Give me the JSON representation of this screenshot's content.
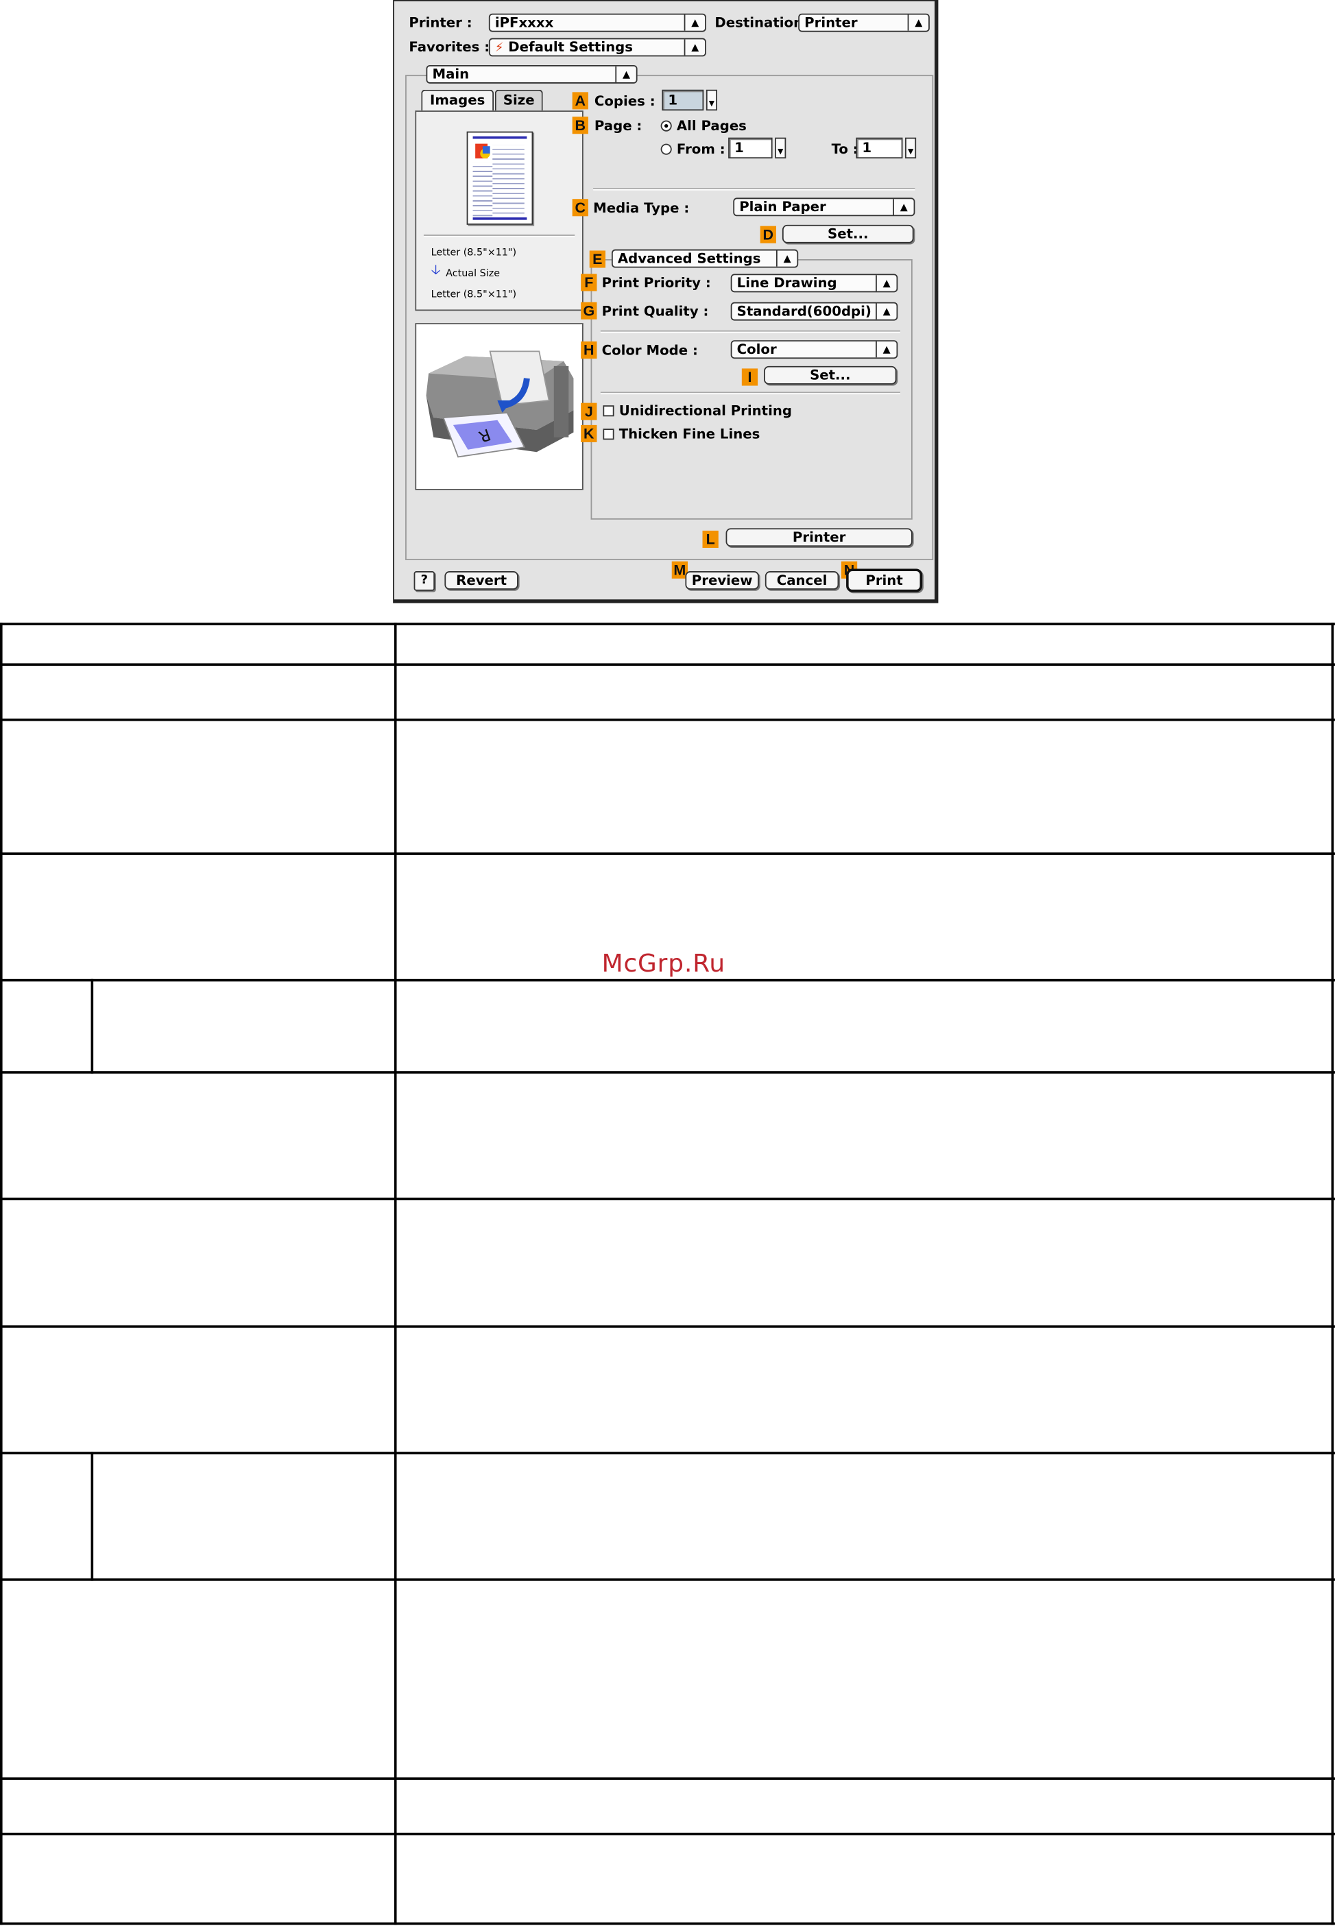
{
  "dialog": {
    "printer_label": "Printer :",
    "printer_value": "iPFxxxx",
    "destination_label": "Destination :",
    "destination_value": "Printer",
    "favorites_label": "Favorites :",
    "favorites_value": "Default Settings",
    "panel_value": "Main",
    "tabs": [
      "Images",
      "Size"
    ],
    "preview": {
      "paper_size_top": "Letter (8.5\"×11\")",
      "scale_label": "Actual Size",
      "paper_size_bottom": "Letter (8.5\"×11\")"
    },
    "copies_label": "Copies :",
    "copies_value": "1",
    "page_label": "Page :",
    "all_pages_label": "All Pages",
    "from_label": "From :",
    "from_value": "1",
    "to_label": "To :",
    "to_value": "1",
    "media_type_label": "Media Type :",
    "media_type_value": "Plain Paper",
    "media_set_button": "Set...",
    "advanced_settings_value": "Advanced Settings",
    "print_priority_label": "Print Priority :",
    "print_priority_value": "Line Drawing",
    "print_quality_label": "Print Quality :",
    "print_quality_value": "Standard(600dpi)",
    "color_mode_label": "Color Mode :",
    "color_mode_value": "Color",
    "color_set_button": "Set...",
    "unidirectional_label": "Unidirectional Printing",
    "thicken_label": "Thicken Fine Lines",
    "printer_button": "Printer",
    "help_button": "?",
    "revert_button": "Revert",
    "preview_button": "Preview",
    "cancel_button": "Cancel",
    "print_button": "Print",
    "callouts": [
      "A",
      "B",
      "C",
      "D",
      "E",
      "F",
      "G",
      "H",
      "I",
      "J",
      "K",
      "L",
      "M",
      "N"
    ]
  },
  "watermark": "McGrp.Ru",
  "colors": {
    "callout": "#f39200",
    "dialog_bg": "#e3e3e3",
    "watermark": "#c0252e"
  }
}
